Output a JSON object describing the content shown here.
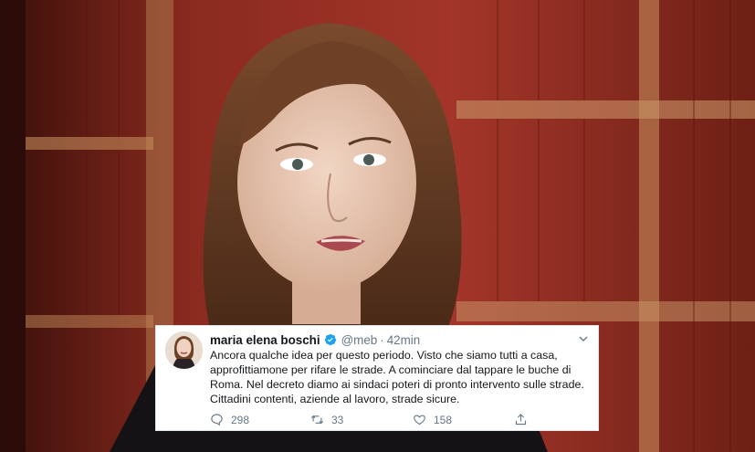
{
  "tweet": {
    "display_name": "maria elena boschi",
    "handle": "@meb",
    "separator": "·",
    "time": "42min",
    "body_lines": [
      "Ancora qualche idea per questo periodo. Visto che siamo tutti a casa,",
      "approfittiamone per rifare le strade. A cominciare dal tappare le buche di",
      "Roma. Nel decreto diamo ai sindaci poteri di pronto intervento sulle strade.",
      "Cittadini contenti, aziende al lavoro, strade sicure."
    ],
    "reply_count": "298",
    "retweet_count": "33",
    "like_count": "158"
  },
  "icons": {
    "verified": "verified-badge-icon",
    "more": "chevron-down-icon",
    "reply": "reply-icon",
    "retweet": "retweet-icon",
    "like": "heart-icon",
    "share": "share-icon"
  },
  "colors": {
    "verified_blue": "#1da1f2",
    "secondary_text": "#657786",
    "primary_text": "#14171a",
    "bookshelf_red": "#8e2a1f"
  }
}
